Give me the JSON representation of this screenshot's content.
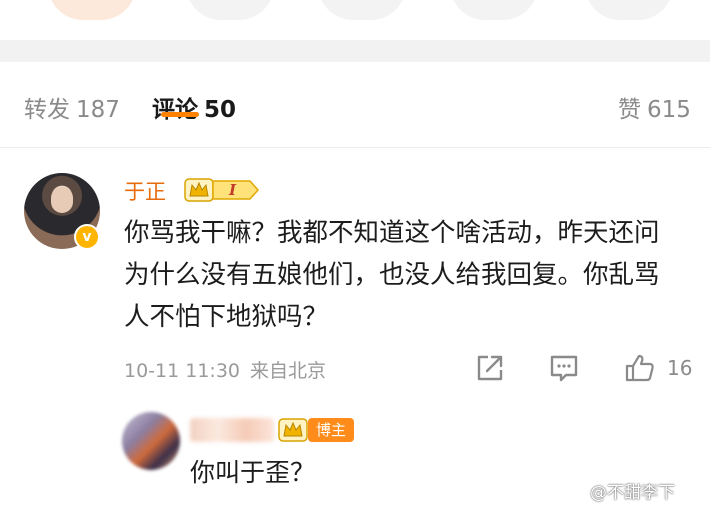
{
  "tabs": {
    "repost": {
      "label": "转发",
      "count": "187"
    },
    "comment": {
      "label": "评论",
      "count": "50"
    },
    "like": {
      "label": "赞",
      "count": "615"
    }
  },
  "comment": {
    "username": "于正",
    "level_badge": "I",
    "text": "你骂我干嘛？我都不知道这个啥活动，昨天还问为什么没有五娘他们，也没人给我回复。你乱骂人不怕下地狱吗？",
    "timestamp": "10-11 11:30",
    "source": "来自北京",
    "like_count": "16",
    "verified_mark": "v"
  },
  "reply": {
    "badge_label": "博主",
    "text": "你叫于歪？"
  },
  "watermark": "@不甜李下",
  "colors": {
    "accent": "#ff8200",
    "username": "#e86b0c",
    "muted": "#8a8a8a"
  }
}
